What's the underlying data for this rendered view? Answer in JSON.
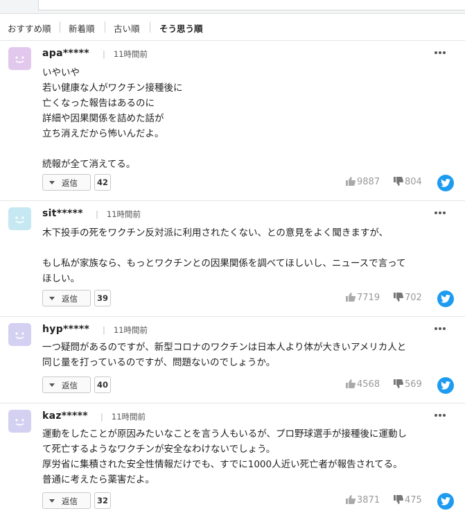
{
  "tabs": [
    {
      "label": "おすすめ順"
    },
    {
      "label": "新着順"
    },
    {
      "label": "古い順"
    },
    {
      "label": "そう思う順"
    }
  ],
  "reply_label": "返信",
  "comments": [
    {
      "user": "apa*****",
      "time": "11時間前",
      "avatar_color": "#e1c8ec",
      "text": "いやいや\n若い健康な人がワクチン接種後に\n亡くなった報告はあるのに\n詳細や因果関係を詰めた話が\n立ち消えだから怖いんだよ。\n\n続報が全て消えてる。",
      "replies": "42",
      "likes": "9887",
      "dislikes": "804"
    },
    {
      "user": "sit*****",
      "time": "11時間前",
      "avatar_color": "#c6e8f2",
      "text": "木下投手の死をワクチン反対派に利用されたくない、との意見をよく聞きますが、\n\nもし私が家族なら、もっとワクチンとの因果関係を調べてほしいし、ニュースで言って\nほしい。",
      "replies": "39",
      "likes": "7719",
      "dislikes": "702"
    },
    {
      "user": "hyp*****",
      "time": "11時間前",
      "avatar_color": "#d3d0f2",
      "text": "一つ疑問があるのですが、新型コロナのワクチンは日本人より体が大きいアメリカ人と\n同じ量を打っているのですが、問題ないのでしょうか。",
      "replies": "40",
      "likes": "4568",
      "dislikes": "569"
    },
    {
      "user": "kaz*****",
      "time": "11時間前",
      "avatar_color": "#d3d0f2",
      "text": "運動をしたことが原因みたいなことを言う人もいるが、プロ野球選手が接種後に運動し\nて死亡するようなワクチンが安全なわけないでしょう。\n厚労省に集積された安全性情報だけでも、すでに1000人近い死亡者が報告されてる。\n普通に考えたら薬害だよ。",
      "replies": "32",
      "likes": "3871",
      "dislikes": "475"
    }
  ]
}
